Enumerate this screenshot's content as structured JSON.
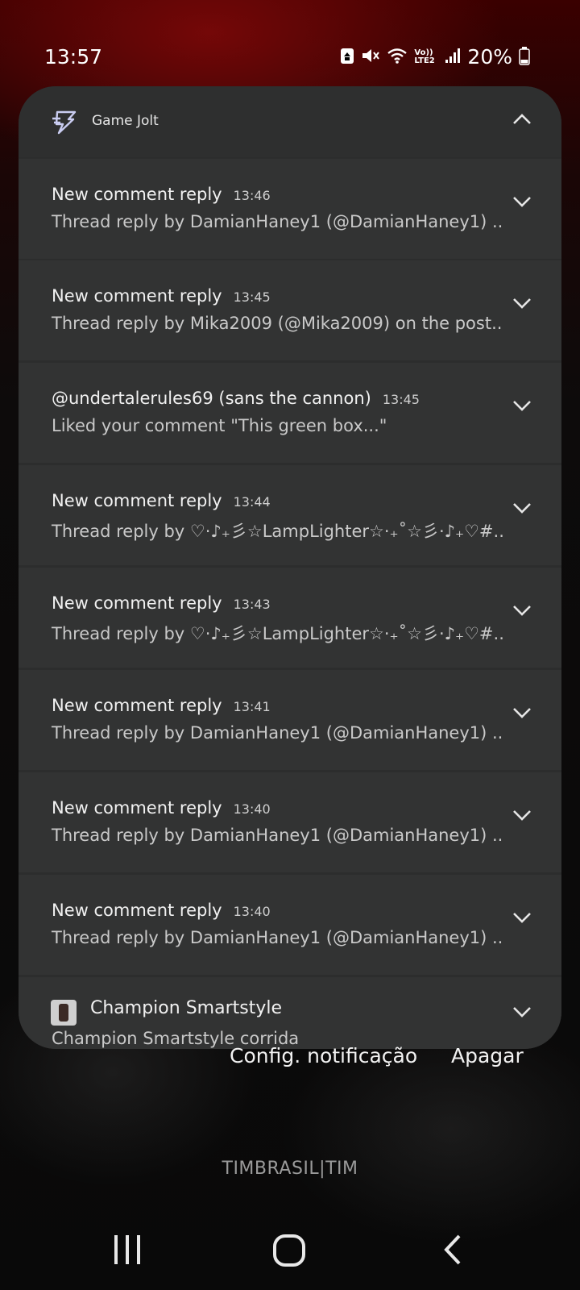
{
  "status_bar": {
    "time": "13:57",
    "battery_percent": "20%",
    "network_label": "Vo)) LTE2",
    "icons": [
      "recycle-icon",
      "mute-icon",
      "wifi-icon",
      "signal-icon",
      "battery-icon"
    ]
  },
  "notification_group": {
    "app_name": "Game Jolt",
    "app_icon": "lightning-icon",
    "expanded": true
  },
  "notifications": [
    {
      "title": "New comment reply",
      "time": "13:46",
      "body": "Thread reply by DamianHaney1 (@DamianHaney1) .."
    },
    {
      "title": "New comment reply",
      "time": "13:45",
      "body": "Thread reply by Mika2009 (@Mika2009) on the post.."
    },
    {
      "title": "@undertalerules69 (sans the cannon)",
      "time": "13:45",
      "body": "Liked your comment \"This green box...\""
    },
    {
      "title": "New comment reply",
      "time": "13:44",
      "body": "Thread reply by ♡·♪₊彡☆LampLighter☆·₊˚☆彡·♪₊♡#.."
    },
    {
      "title": "New comment reply",
      "time": "13:43",
      "body": "Thread reply by ♡·♪₊彡☆LampLighter☆·₊˚☆彡·♪₊♡#.."
    },
    {
      "title": "New comment reply",
      "time": "13:41",
      "body": "Thread reply by DamianHaney1 (@DamianHaney1) .."
    },
    {
      "title": "New comment reply",
      "time": "13:40",
      "body": "Thread reply by DamianHaney1 (@DamianHaney1) .."
    },
    {
      "title": "New comment reply",
      "time": "13:40",
      "body": "Thread reply by DamianHaney1 (@DamianHaney1) .."
    }
  ],
  "next_notification": {
    "app_name": "Champion Smartstyle",
    "body": "Champion Smartstyle corrida",
    "icon": "watch-icon"
  },
  "actions": {
    "settings_label": "Config. notificação",
    "clear_label": "Apagar"
  },
  "carrier": "TIMBRASIL|TIM",
  "nav": {
    "recents": "recents-icon",
    "home": "home-icon",
    "back": "back-icon"
  }
}
